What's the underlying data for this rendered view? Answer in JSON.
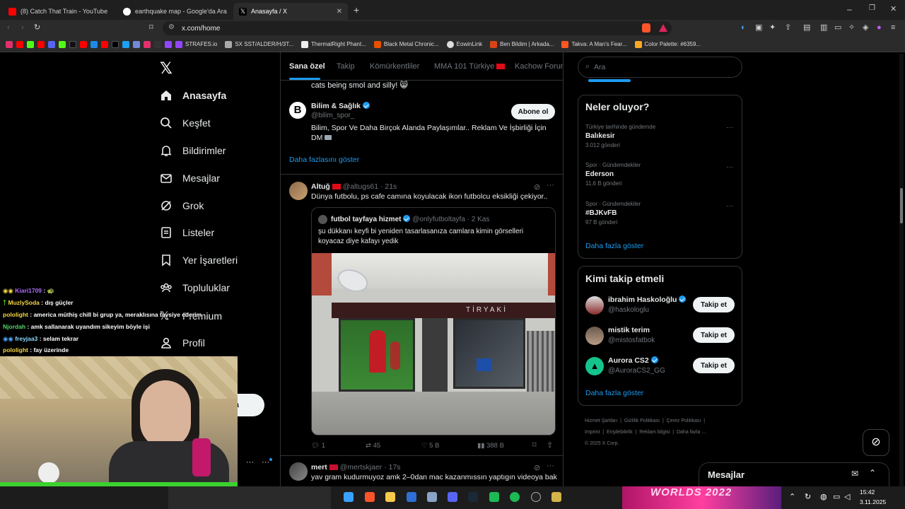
{
  "browser": {
    "tabs": [
      {
        "title": "(8) Catch That Train - YouTube",
        "active": false
      },
      {
        "title": "earthquake map - Google'da Ara",
        "active": false
      },
      {
        "title": "Anasayfa / X",
        "active": true
      }
    ],
    "url": "x.com/home",
    "bookmarks": [
      "STRAFES.io",
      "SX SST/ALDER/H/3T...",
      "ThermalRight Phant...",
      "Black Metal Chronic...",
      "EowinLink",
      "Ben Bildim | Arkada...",
      "Takva: A Man's Fear...",
      "Color Palette: #6359..."
    ]
  },
  "sidebar": {
    "items": [
      {
        "label": "Anasayfa",
        "icon": "home-icon",
        "active": true
      },
      {
        "label": "Keşfet",
        "icon": "search-icon"
      },
      {
        "label": "Bildirimler",
        "icon": "bell-icon"
      },
      {
        "label": "Mesajlar",
        "icon": "envelope-icon"
      },
      {
        "label": "Grok",
        "icon": "grok-icon"
      },
      {
        "label": "Listeler",
        "icon": "list-icon"
      },
      {
        "label": "Yer İşaretleri",
        "icon": "bookmark-icon"
      },
      {
        "label": "Topluluklar",
        "icon": "people-icon"
      },
      {
        "label": "Premium",
        "icon": "x-logo-icon"
      },
      {
        "label": "Profil",
        "icon": "person-icon"
      }
    ],
    "post_button": "a"
  },
  "feed": {
    "tabs": [
      "Sana özel",
      "Takip",
      "Kömürkentliler",
      "MMA 101 Türkiye",
      "Kachow Forum"
    ],
    "prev_snippet": "cats being smol and silly! 😸",
    "suggested": {
      "name": "Bilim & Sağlık",
      "handle": "@bilim_spor_",
      "bio": "Bilim, Spor Ve Daha Birçok Alanda Paylaşımlar.. Reklam Ve İşbirliği İçin DM",
      "button": "Abone ol",
      "more": "Daha fazlasını göster"
    },
    "post1": {
      "name": "Altuğ",
      "handle": "@altugs61",
      "time": "· 21s",
      "text": "Dünya futbolu, ps cafe camına koyulacak ikon futbolcu eksikliği çekiyor..",
      "quote": {
        "name": "futbol tayfaya hizmet",
        "handle": "@onlyfutboltayfa",
        "time": "· 2 Kas",
        "text": "şu dükkanı keyfi bi yeniden tasarlasanıza camlara kimin görselleri koyacaz diye kafayı yedik",
        "shop_sign": "TİRYAKİ"
      },
      "replies": "1",
      "reposts": "45",
      "likes": "5 B",
      "views": "388 B"
    },
    "post2": {
      "name": "mert",
      "handle": "@mertskjaer",
      "time": "· 17s",
      "text": "yav gram kudurmuyoz amk 2–0dan mac kazanmıssın yaptıgın videoya bak"
    }
  },
  "right": {
    "search_placeholder": "Ara",
    "trends_title": "Neler oluyor?",
    "trends": [
      {
        "context": "Türkiye tarihinde gündemde",
        "name": "Balıkesir",
        "count": "3.012 gönderi"
      },
      {
        "context": "Spor · Gündemdekiler",
        "name": "Ederson",
        "count": "11,6 B gönderi"
      },
      {
        "context": "Spor · Gündemdekiler",
        "name": "#BJKvFB",
        "count": "97 B gönderi"
      }
    ],
    "trends_more": "Daha fazla göster",
    "follow_title": "Kimi takip etmeli",
    "follow": [
      {
        "name": "ibrahim Haskoloğlu",
        "handle": "@haskologlu",
        "verified": true
      },
      {
        "name": "mistik terim",
        "handle": "@mistosfatbok",
        "verified": false
      },
      {
        "name": "Aurora CS2",
        "handle": "@AuroraCS2_GG",
        "verified": true
      }
    ],
    "follow_button": "Takip et",
    "follow_more": "Daha fazla göster",
    "footer": [
      "Hizmet Şartları",
      "Gizlilik Politikası",
      "Çerez Politikası",
      "Imprint",
      "Erişilebilirlik",
      "Reklam bilgisi",
      "Daha fazla ...",
      "© 2025 X Corp."
    ]
  },
  "messages_drawer": {
    "title": "Mesajlar"
  },
  "chat": [
    {
      "user": "Kiari1709",
      "msg": " : 🐢",
      "color": "#b06cff"
    },
    {
      "user": "MuzlySoda",
      "msg": " : dış güçler",
      "color": "#f6d743"
    },
    {
      "user": "pololight",
      "msg": " : america müthiş chill bi grup ya, meraklısına tavsiye ederim",
      "color": "#f6d743"
    },
    {
      "user": "Njordah",
      "msg": " : amk sallanarak uyandım sikeyim böyle işi",
      "color": "#58d66a"
    },
    {
      "user": "freyjaa3",
      "msg": " : selam tekrar",
      "color": "#8ad8ff"
    },
    {
      "user": "pololight",
      "msg": " : fay üzerinde",
      "color": "#f6d743"
    }
  ],
  "taskbar": {
    "banner": "WORLDS 2022",
    "time": "15:42",
    "date": "3.11.2025"
  },
  "colors": {
    "accent": "#1d9bf0",
    "background": "#000000",
    "border": "#2f3336",
    "muted": "#71767b"
  }
}
